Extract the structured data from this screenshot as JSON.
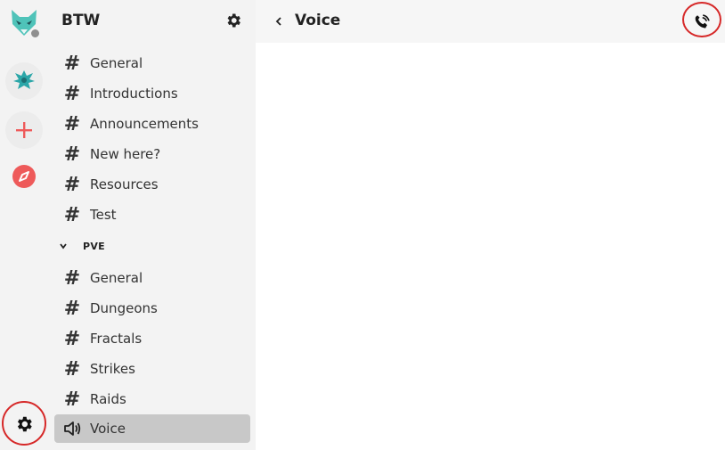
{
  "rail": {
    "avatar_icon": "fox-avatar-icon",
    "status": "offline",
    "servers": [
      {
        "name": "guild-emblem",
        "icon": "phoenix-emblem-icon"
      }
    ],
    "add_icon": "plus-icon",
    "explore_icon": "compass-icon",
    "settings_icon": "gear-icon"
  },
  "sidebar": {
    "server_name": "BTW",
    "settings_icon": "gear-icon",
    "channels": [
      {
        "label": "General"
      },
      {
        "label": "Introductions"
      },
      {
        "label": "Announcements"
      },
      {
        "label": "New here?"
      },
      {
        "label": "Resources"
      },
      {
        "label": "Test"
      }
    ],
    "category": {
      "label": "PVE",
      "channels": [
        {
          "label": "General"
        },
        {
          "label": "Dungeons"
        },
        {
          "label": "Fractals"
        },
        {
          "label": "Strikes"
        },
        {
          "label": "Raids"
        },
        {
          "label": "Voice",
          "type": "voice",
          "active": true
        }
      ]
    }
  },
  "main": {
    "title": "Voice",
    "back_icon": "chevron-left-icon",
    "call_icon": "phone-call-icon"
  },
  "colors": {
    "rail_bg": "#f3f3f3",
    "active_channel": "#c8c8c8",
    "accent_red": "#ee5a5a",
    "highlight_ring": "#d62828",
    "teal": "#2aa6a8"
  }
}
